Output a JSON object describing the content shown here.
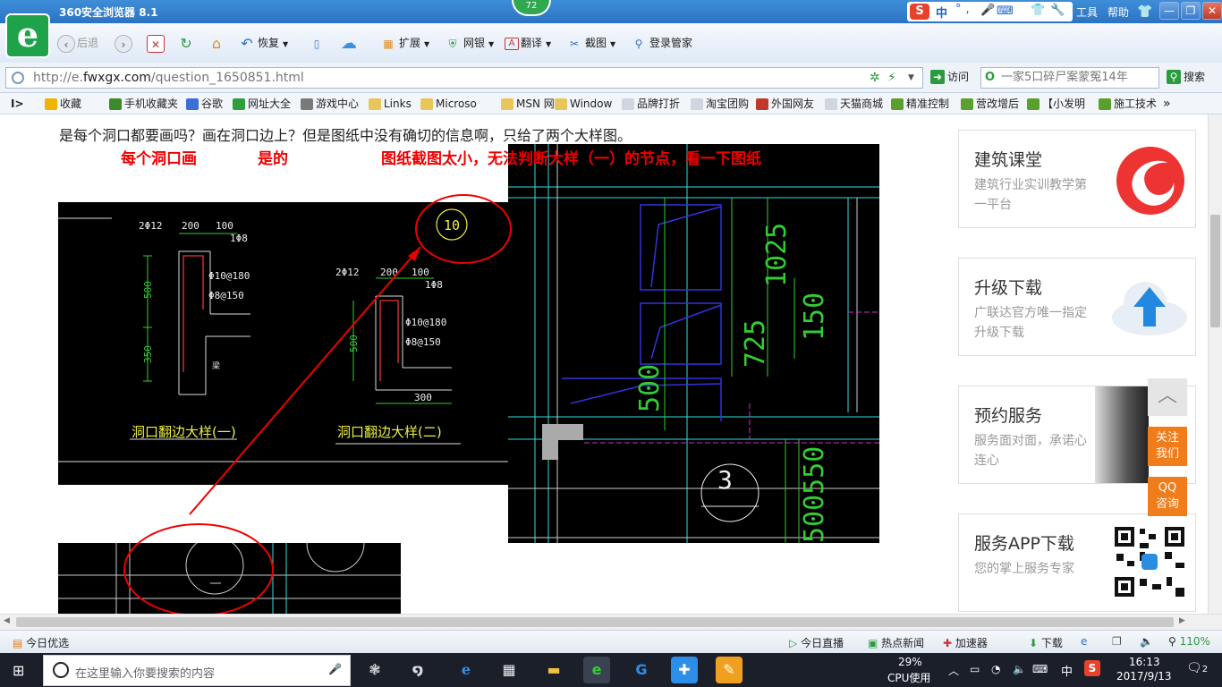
{
  "window": {
    "title": "360安全浏览器 8.1",
    "badge": "72",
    "ime_char": "中",
    "ime_extra": "°,",
    "menu_tools": "工具",
    "menu_help": "帮助",
    "min": "—",
    "max": "❐",
    "close": "✕"
  },
  "toolbar": {
    "back": "后退",
    "restore": "恢复",
    "extend": "扩展",
    "netbank": "网银",
    "translate": "翻译",
    "screenshot": "截图",
    "login": "登录管家"
  },
  "address": {
    "prefix": "http://e.",
    "host": "fwxgx.com",
    "path": "/question_1650851.html",
    "visit": "访问",
    "search_value": "一家5口碎尸案蒙冤14年",
    "search": "搜索"
  },
  "bookmarks": [
    {
      "label": "收藏",
      "color": "#f0b400"
    },
    {
      "label": "手机收藏夹",
      "color": "#3c8b2a"
    },
    {
      "label": "谷歌",
      "color": "#3a6fd8"
    },
    {
      "label": "网址大全",
      "color": "#2f9e3b"
    },
    {
      "label": "游戏中心",
      "color": "#7a7a7a"
    },
    {
      "label": "Links",
      "color": "#e8c65a"
    },
    {
      "label": "Microso",
      "color": "#e8c65a"
    },
    {
      "label": "MSN 网",
      "color": "#e8c65a"
    },
    {
      "label": "Window",
      "color": "#e8c65a"
    },
    {
      "label": "品牌打折",
      "color": "#cfd6df"
    },
    {
      "label": "淘宝团购",
      "color": "#cfd6df"
    },
    {
      "label": "外国网友",
      "color": "#c0392b"
    },
    {
      "label": "天猫商城",
      "color": "#cfd6df"
    },
    {
      "label": "精准控制",
      "color": "#5aa02c"
    },
    {
      "label": "营改增后",
      "color": "#5aa02c"
    },
    {
      "label": "【小发明",
      "color": "#5aa02c"
    },
    {
      "label": "施工技术",
      "color": "#5aa02c"
    }
  ],
  "content": {
    "question": "是每个洞口都要画吗？画在洞口边上？但是图纸中没有确切的信息啊，只给了两个大样图。",
    "ann1": "每个洞口画",
    "ann2": "是的",
    "ann3": "图纸截图太小，无法判断大样（一）的节点，看一下图纸",
    "drawing1": {
      "circle_label": "10",
      "left_rebar": "2Φ12",
      "dim200": "200",
      "dim100": "100",
      "stirrup": "1Φ8",
      "phi10": "Φ10@180",
      "phi8": "Φ8@150",
      "dim500": "500",
      "dim350": "350",
      "beam": "梁",
      "detail1": "洞口翻边大样(一)",
      "detail2": "洞口翻边大样(二)",
      "dim300": "300"
    },
    "drawing2": {
      "dim725": "725",
      "dim1025": "1025",
      "dim150": "150",
      "dim500": "500",
      "dim500550": "500550",
      "circle3": "3"
    }
  },
  "sidebar": [
    {
      "title": "建筑课堂",
      "desc": "建筑行业实训教学第一平台",
      "icon": "logo-swirl-icon"
    },
    {
      "title": "升级下载",
      "desc": "广联达官方唯一指定升级下载",
      "icon": "cloud-upload-icon"
    },
    {
      "title": "预约服务",
      "desc": "服务面对面，承诺心连心",
      "icon": "handshake-photo-icon"
    },
    {
      "title": "服务APP下载",
      "desc": "您的掌上服务专家",
      "icon": "qr-code-icon"
    }
  ],
  "floatbar": {
    "top": "︿",
    "follow": "关注我们",
    "qq": "QQ咨询"
  },
  "statusbar": {
    "today": "今日优选",
    "live": "今日直播",
    "hotnews": "热点新闻",
    "accelerator": "加速器",
    "download": "下载",
    "zoom": "110%"
  },
  "taskbar": {
    "search_placeholder": "在这里输入你要搜索的内容",
    "cpu_pct": "29%",
    "cpu_label": "CPU使用",
    "ime": "中",
    "time": "16:13",
    "date": "2017/9/13",
    "notify": "2"
  }
}
